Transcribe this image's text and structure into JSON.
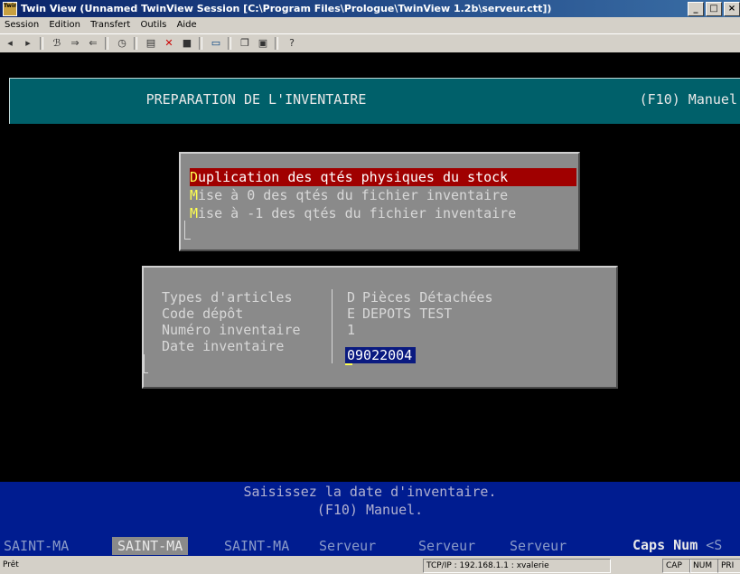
{
  "window": {
    "title": "Twin View (Unnamed TwinView Session [C:\\Program Files\\Prologue\\TwinView 1.2b\\serveur.ctt])",
    "icon_label": "Twin View",
    "buttons": {
      "minimize": "_",
      "maximize": "□",
      "close": "×"
    }
  },
  "menu": [
    "Session",
    "Edition",
    "Transfert",
    "Outils",
    "Aide"
  ],
  "toolbar_icons": [
    "back-icon",
    "forward-icon",
    "connect-icon",
    "send-icon",
    "receive-icon",
    "clock-icon",
    "macro-icon",
    "disconnect-icon",
    "stop-icon",
    "screen-icon",
    "copy-icon",
    "paste-icon",
    "help-icon"
  ],
  "terminal": {
    "header": {
      "title": "PREPARATION DE L'INVENTAIRE",
      "shortcut": "(F10) Manuel"
    },
    "options": [
      {
        "hotkey": "D",
        "rest": "uplication des qtés physiques du stock",
        "selected": true
      },
      {
        "hotkey": "M",
        "rest": "ise à  0 des qtés du fichier inventaire",
        "selected": false
      },
      {
        "hotkey": "M",
        "rest": "ise à -1 des qtés du fichier inventaire",
        "selected": false
      }
    ],
    "form": {
      "type_label": "Types d'articles",
      "type_code": "D",
      "type_value": "Pièces Détachées",
      "depot_label": "Code dépôt",
      "depot_code": "E",
      "depot_value": "DEPOTS TEST",
      "numero_label": "Numéro inventaire",
      "numero_value": "1",
      "date_label": "Date inventaire",
      "date_value": "09022004"
    },
    "message": {
      "line1": "Saisissez la date d'inventaire.",
      "line2": "(F10) Manuel."
    },
    "sessions": [
      {
        "label": "SAINT-MA",
        "active": false
      },
      {
        "label": "SAINT-MA",
        "active": true
      },
      {
        "label": "SAINT-MA",
        "active": false
      },
      {
        "label": "Serveur",
        "active": false
      },
      {
        "label": "Serveur",
        "active": false
      },
      {
        "label": "Serveur",
        "active": false
      }
    ],
    "indicators": {
      "caps": "Caps Num",
      "suffix": "<S"
    }
  },
  "statusbar": {
    "ready": "Prêt",
    "connection": "TCP/IP : 192.168.1.1 : xvalerie",
    "cap": "CAP",
    "num": "NUM",
    "pri": "PRI"
  },
  "colors": {
    "header_bg": "#00606a",
    "selected_option": "#a00000",
    "hotkey": "#ffff50",
    "message_bg": "#001c90",
    "input_bg": "#0a1a80"
  }
}
